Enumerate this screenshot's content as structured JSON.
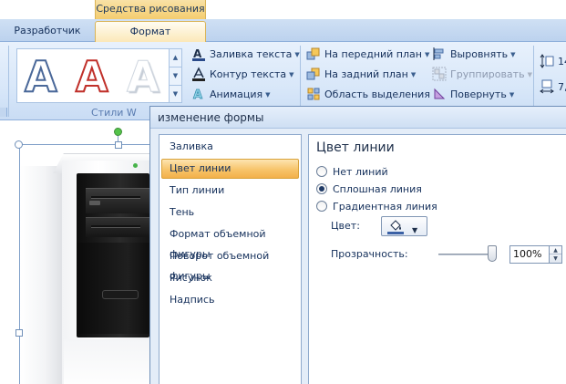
{
  "ribbon": {
    "context_header": "Средства рисования",
    "tabs": [
      {
        "label": "Разработчик",
        "active": false
      },
      {
        "label": "Формат",
        "active": true
      }
    ],
    "wordart_group": {
      "gallery_letters": [
        "A",
        "A",
        "A"
      ],
      "label": "Стили W",
      "buttons": [
        {
          "label": "Заливка текста",
          "icon": "text-fill-icon"
        },
        {
          "label": "Контур текста",
          "icon": "text-outline-icon"
        },
        {
          "label": "Анимация",
          "icon": "text-effects-icon"
        }
      ]
    },
    "arrange_group": {
      "buttons": [
        {
          "label": "На передний план",
          "icon": "bring-to-front-icon",
          "enabled": true
        },
        {
          "label": "На задний план",
          "icon": "send-to-back-icon",
          "enabled": true
        },
        {
          "label": "Область выделения",
          "icon": "selection-pane-icon",
          "enabled": true
        },
        {
          "label": "Выровнять",
          "icon": "align-icon",
          "enabled": true
        },
        {
          "label": "Группировать",
          "icon": "group-icon",
          "enabled": false
        },
        {
          "label": "Повернуть",
          "icon": "rotate-icon",
          "enabled": true
        }
      ]
    },
    "size_group": {
      "height_value": "14",
      "width_value": "7,"
    }
  },
  "dialog": {
    "title": "изменение формы",
    "categories": [
      {
        "label": "Заливка",
        "selected": false
      },
      {
        "label": "Цвет линии",
        "selected": true
      },
      {
        "label": "Тип линии",
        "selected": false
      },
      {
        "label": "Тень",
        "selected": false
      },
      {
        "label": "Формат объемной фигуры",
        "selected": false
      },
      {
        "label": "Поворот объемной фигуры",
        "selected": false
      },
      {
        "label": "Рисунок",
        "selected": false
      },
      {
        "label": "Надпись",
        "selected": false
      }
    ],
    "panel": {
      "heading": "Цвет линии",
      "options": [
        {
          "label": "Нет линий",
          "checked": false
        },
        {
          "label": "Сплошная линия",
          "checked": true
        },
        {
          "label": "Градиентная линия",
          "checked": false
        }
      ],
      "color_label": "Цвет:",
      "color_value": "#3b61a5",
      "transparency_label": "Прозрачность:",
      "transparency_value": "100%",
      "transparency_fraction": 1.0
    }
  },
  "colors": {
    "accent_selected": "#f7c46a",
    "ribbon_bg": "#d8e7f9",
    "context_tab": "#f4cd6f"
  }
}
